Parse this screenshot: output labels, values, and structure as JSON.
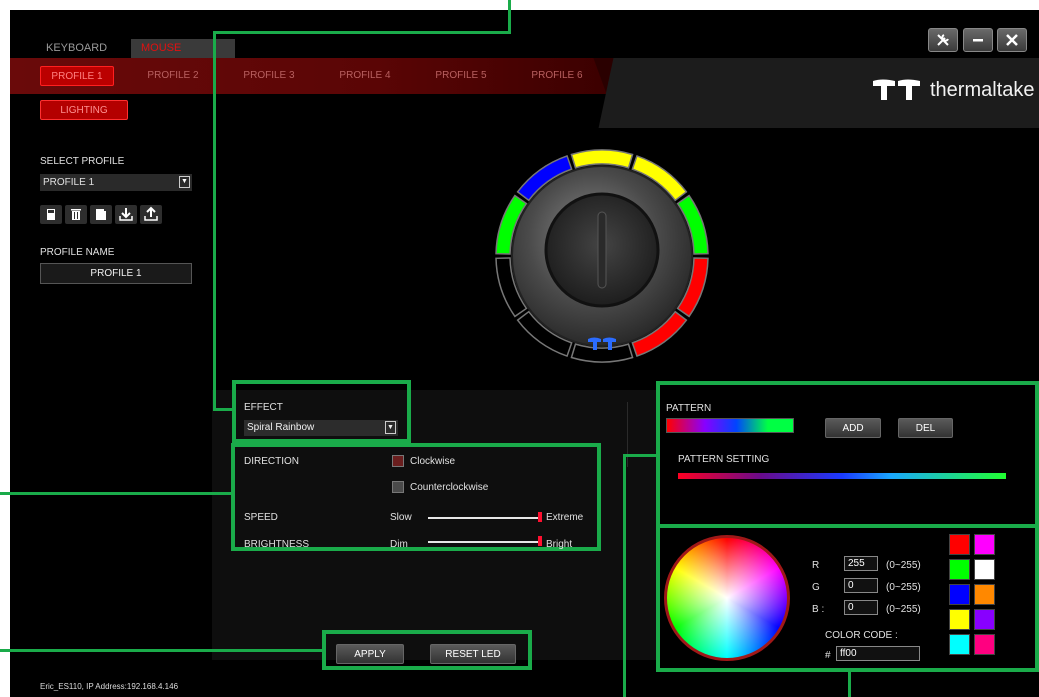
{
  "top_tabs": [
    {
      "label": "KEYBOARD"
    },
    {
      "label": "MOUSE BUNGEE"
    }
  ],
  "profile_tabs": [
    "PROFILE 1",
    "PROFILE 2",
    "PROFILE 3",
    "PROFILE 4",
    "PROFILE 5",
    "PROFILE 6"
  ],
  "lighting_label": "LIGHTING",
  "brand": {
    "word": "thermaltake"
  },
  "select_profile": {
    "label": "SELECT PROFILE",
    "value": "PROFILE 1"
  },
  "profile_name": {
    "label": "PROFILE NAME",
    "value": "PROFILE 1"
  },
  "effect": {
    "label": "EFFECT",
    "value": "Spiral Rainbow"
  },
  "direction": {
    "label": "DIRECTION",
    "options": [
      "Clockwise",
      "Counterclockwise"
    ]
  },
  "speed": {
    "label": "SPEED",
    "min_label": "Slow",
    "max_label": "Extreme",
    "level": 1.0
  },
  "brightness": {
    "label": "BRIGHTNESS",
    "min_label": "Dim",
    "max_label": "Bright",
    "level": 1.0
  },
  "pattern": {
    "label": "PATTERN",
    "add_label": "ADD",
    "del_label": "DEL",
    "setting_label": "PATTERN SETTING"
  },
  "color": {
    "r_label": "R",
    "g_label": "G",
    "b_label": "B :",
    "r": "255",
    "g": "0",
    "b": "0",
    "range": "(0~255)",
    "code_label": "COLOR CODE :",
    "hash": "#",
    "code": "ff00"
  },
  "swatches": [
    "#ff0000",
    "#ff00ff",
    "#00ff00",
    "#ffffff",
    "#0000ff",
    "#ff8800",
    "#ffff00",
    "#8800ff",
    "#00ffff",
    "#ff0080"
  ],
  "ring_colors": [
    "#ffff00",
    "#ffff00",
    "#00ff00",
    "#ff0000",
    "#ff0000",
    "#000000",
    "#000000",
    "#000000",
    "#00ff00",
    "#0000ff"
  ],
  "actions": {
    "apply": "APPLY",
    "reset": "RESET LED"
  },
  "status": "Eric_ES110, IP Address:192.168.4.146",
  "accent": "#1aab4a"
}
